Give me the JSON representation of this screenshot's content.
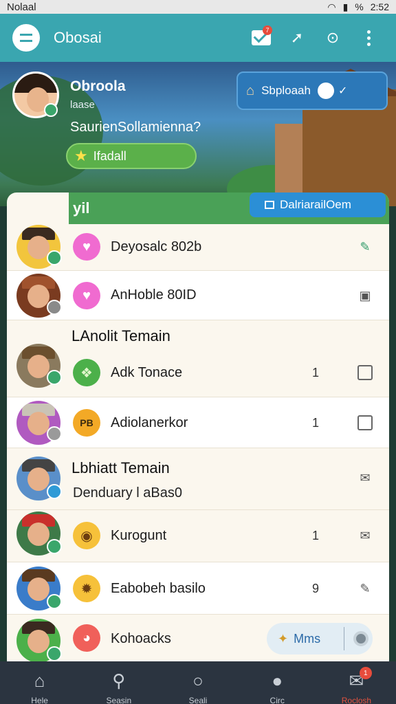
{
  "status_bar": {
    "carrier": "Nolaal",
    "time": "2:52",
    "battery": "%"
  },
  "app_bar": {
    "title": "Obosai",
    "mail_badge": "7"
  },
  "profile": {
    "name": "Obroola",
    "subtitle": "laase",
    "status": "SaurienSollamienna?",
    "level_label": "Ifadall",
    "share_label": "Sbploaah"
  },
  "panel": {
    "header_label": "yil",
    "dashboard_label": "DalriarailOem"
  },
  "rows": [
    {
      "label": "Deyosalc 802b",
      "count": ""
    },
    {
      "label": "AnHoble 80ID",
      "count": ""
    },
    {
      "section": "LAnolit Temain",
      "label": "Adk Tonace",
      "count": "1"
    },
    {
      "label": "Adiolanerkor",
      "count": "1",
      "icon_text": "PB"
    },
    {
      "section": "Lbhiatt Temain",
      "sub": "Denduary l aBas0"
    },
    {
      "label": "Kurogunt",
      "count": "1"
    },
    {
      "label": "Eabobeh basilo",
      "count": "9"
    },
    {
      "label": "Kohoacks",
      "more_label": "Mms"
    }
  ],
  "bottom_nav": [
    {
      "label": "Hele"
    },
    {
      "label": "Seasin"
    },
    {
      "label": "Seali"
    },
    {
      "label": "Circ"
    },
    {
      "label": "Roclosh",
      "badge": "1"
    }
  ],
  "colors": {
    "app_bar": "#3aa6b0",
    "panel_header": "#4aa157",
    "dashboard_button": "#2b8fd6",
    "share_button": "#2c78b8",
    "bottom_nav": "#2b3440",
    "active_nav": "#e5533f"
  }
}
